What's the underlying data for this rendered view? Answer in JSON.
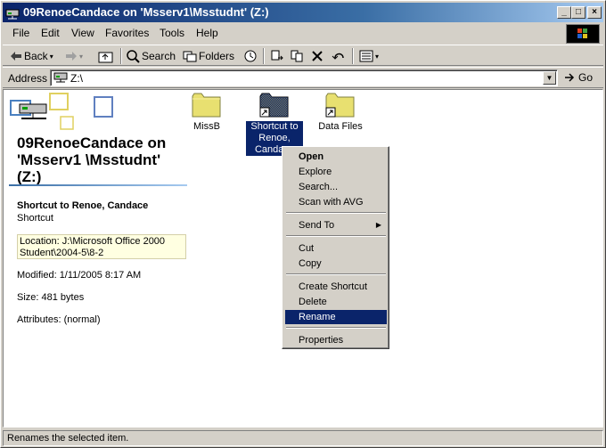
{
  "window": {
    "title": "09RenoeCandace on 'Msserv1\\Msstudnt' (Z:)",
    "controls": [
      "minimize",
      "maximize",
      "close"
    ]
  },
  "menubar": {
    "items": [
      "File",
      "Edit",
      "View",
      "Favorites",
      "Tools",
      "Help"
    ]
  },
  "toolbar": {
    "back": "Back",
    "search": "Search",
    "folders": "Folders"
  },
  "address": {
    "label": "Address",
    "value": "Z:\\",
    "go": "Go"
  },
  "infopane": {
    "drive_title": "09RenoeCandace on 'Msserv1 \\Msstudnt' (Z:)",
    "item_name": "Shortcut to Renoe, Candace",
    "item_type": "Shortcut",
    "location": "Location: J:\\Microsoft Office 2000 Student\\2004-5\\8-2",
    "modified": "Modified: 1/11/2005 8:17 AM",
    "size": "Size: 481 bytes",
    "attributes": "Attributes: (normal)"
  },
  "files": [
    {
      "name": "MissB",
      "icon": "folder-icon",
      "selected": false
    },
    {
      "name": "Shortcut to Renoe, Candace",
      "icon": "shortcut-folder-icon",
      "selected": true
    },
    {
      "name": "Data Files",
      "icon": "shortcut-folder-icon",
      "selected": false
    }
  ],
  "context_menu": {
    "items": [
      "Open",
      "Explore",
      "Search...",
      "Scan with AVG",
      "Send To",
      "Cut",
      "Copy",
      "Create Shortcut",
      "Delete",
      "Rename",
      "Properties"
    ],
    "highlighted": "Rename"
  },
  "status": {
    "text": "Renames the selected item."
  },
  "colors": {
    "title_active": "#0a246a",
    "face": "#d4d0c8",
    "highlight": "#0a246a",
    "folder": "#e8e070",
    "info_tip": "#ffffe1"
  }
}
